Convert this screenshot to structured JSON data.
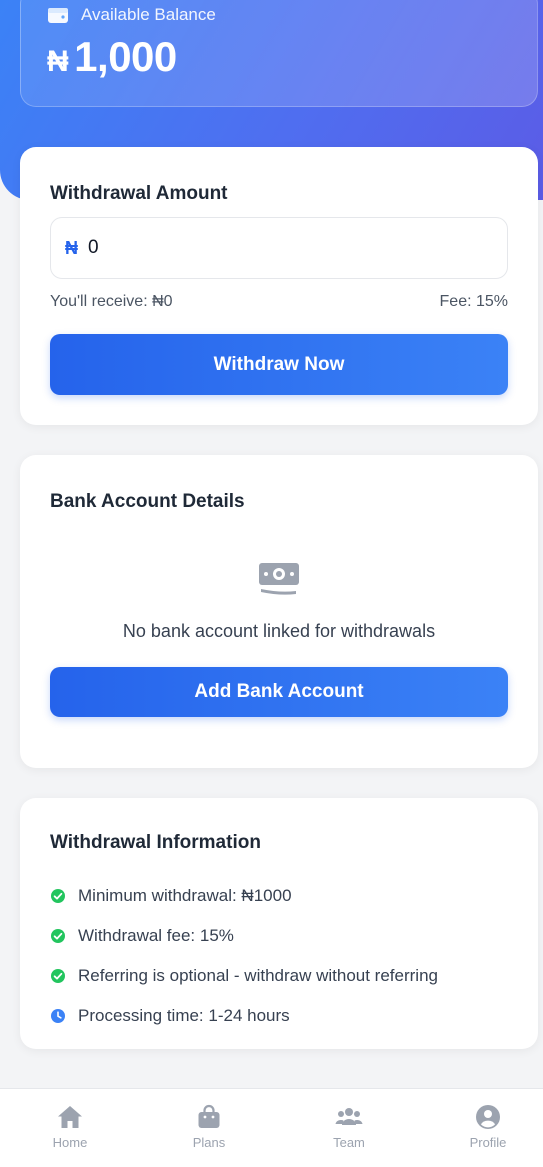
{
  "balance": {
    "label": "Available Balance",
    "currency_symbol": "₦",
    "amount": "1,000"
  },
  "withdraw": {
    "title": "Withdrawal Amount",
    "currency_symbol": "₦",
    "amount_value": "0",
    "receive_text": "You'll receive: ₦0",
    "fee_text": "Fee: 15%",
    "button_label": "Withdraw Now"
  },
  "bank": {
    "title": "Bank Account Details",
    "empty_text": "No bank account linked for withdrawals",
    "button_label": "Add Bank Account",
    "icon": "money-bill-icon"
  },
  "info": {
    "title": "Withdrawal Information",
    "items": [
      {
        "text": "Minimum withdrawal: ₦1000",
        "icon": "check-circle-icon"
      },
      {
        "text": "Withdrawal fee: 15%",
        "icon": "check-circle-icon"
      },
      {
        "text": "Referring is optional - withdraw without referring",
        "icon": "check-circle-icon"
      },
      {
        "text": "Processing time: 1-24 hours",
        "icon": "clock-icon"
      }
    ]
  },
  "nav": {
    "items": [
      {
        "label": "Home",
        "icon": "home-icon"
      },
      {
        "label": "Plans",
        "icon": "shopping-bag-icon"
      },
      {
        "label": "Team",
        "icon": "users-icon"
      },
      {
        "label": "Profile",
        "icon": "user-circle-icon"
      }
    ]
  },
  "colors": {
    "primary": "#2563eb",
    "primary_light": "#3b82f6",
    "success": "#22c55e",
    "muted": "#9ca3af"
  }
}
